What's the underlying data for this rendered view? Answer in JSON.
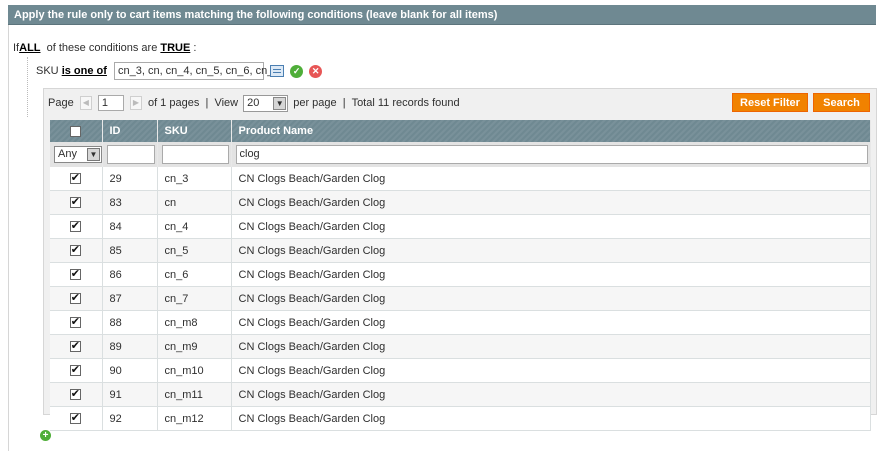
{
  "header": {
    "title": "Apply the rule only to cart items matching the following conditions (leave blank for all items)"
  },
  "condition": {
    "prefix": "If",
    "aggregator": "ALL",
    "middle": "of these conditions are",
    "value": "TRUE",
    "suffix": ":"
  },
  "sku_condition": {
    "attribute": "SKU",
    "operator": "is one of",
    "value": "cn_3, cn, cn_4, cn_5, cn_6, cn_"
  },
  "pager": {
    "page_label": "Page",
    "page_value": "1",
    "of_pages": "of 1 pages",
    "separator": "|",
    "view_label": "View",
    "view_value": "20",
    "per_page": "per page",
    "records": "Total 11 records found"
  },
  "buttons": {
    "reset": "Reset Filter",
    "search": "Search"
  },
  "grid": {
    "columns": [
      "ID",
      "SKU",
      "Product Name"
    ],
    "filter": {
      "in_products": "Any",
      "id": "",
      "sku": "",
      "name": "clog"
    },
    "rows": [
      {
        "id": "29",
        "sku": "cn_3",
        "name": "CN Clogs Beach/Garden Clog",
        "checked": true
      },
      {
        "id": "83",
        "sku": "cn",
        "name": "CN Clogs Beach/Garden Clog",
        "checked": true
      },
      {
        "id": "84",
        "sku": "cn_4",
        "name": "CN Clogs Beach/Garden Clog",
        "checked": true
      },
      {
        "id": "85",
        "sku": "cn_5",
        "name": "CN Clogs Beach/Garden Clog",
        "checked": true
      },
      {
        "id": "86",
        "sku": "cn_6",
        "name": "CN Clogs Beach/Garden Clog",
        "checked": true
      },
      {
        "id": "87",
        "sku": "cn_7",
        "name": "CN Clogs Beach/Garden Clog",
        "checked": true
      },
      {
        "id": "88",
        "sku": "cn_m8",
        "name": "CN Clogs Beach/Garden Clog",
        "checked": true
      },
      {
        "id": "89",
        "sku": "cn_m9",
        "name": "CN Clogs Beach/Garden Clog",
        "checked": true
      },
      {
        "id": "90",
        "sku": "cn_m10",
        "name": "CN Clogs Beach/Garden Clog",
        "checked": true
      },
      {
        "id": "91",
        "sku": "cn_m11",
        "name": "CN Clogs Beach/Garden Clog",
        "checked": true
      },
      {
        "id": "92",
        "sku": "cn_m12",
        "name": "CN Clogs Beach/Garden Clog",
        "checked": true
      }
    ]
  },
  "colors": {
    "header_bg": "#6f8992",
    "button_orange": "#f18200",
    "apply_green": "#4fae39",
    "remove_red": "#e75656"
  },
  "icons": {
    "chooser": "list-chooser-icon",
    "apply": "check-circle-icon",
    "remove": "remove-circle-icon",
    "add": "add-condition-icon"
  }
}
